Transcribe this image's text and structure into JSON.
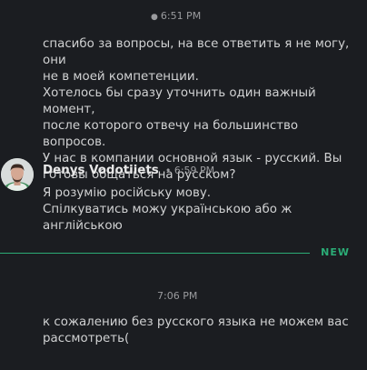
{
  "messages": [
    {
      "time": "6:51 PM",
      "text": "спасибо за вопросы, на все ответить я не могу, они\nне в моей компетенции.\nХотелось бы сразу уточнить один важный момент,\nпосле которого отвечу на большинство вопросов.\nУ нас в компании основной язык - русский. Вы\nготовы общаться на русском?"
    },
    {
      "author": "Denys Vodotiiets",
      "time": "6:59 PM",
      "text": "Я розумію російську мову.\nСпілкуватись можу українською або ж англійською"
    },
    {
      "time": "7:06 PM",
      "text": "к сожалению без русского языка не можем вас\nрассмотреть("
    }
  ],
  "divider": {
    "label": "NEW",
    "color": "#2bac76"
  }
}
